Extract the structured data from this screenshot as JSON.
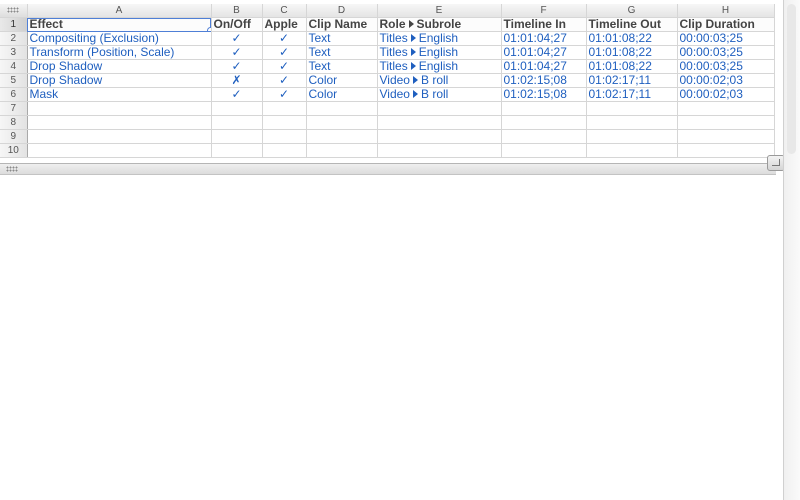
{
  "columns": [
    "A",
    "B",
    "C",
    "D",
    "E",
    "F",
    "G",
    "H"
  ],
  "rows": [
    "1",
    "2",
    "3",
    "4",
    "5",
    "6",
    "7",
    "8",
    "9",
    "10"
  ],
  "header": {
    "effect": "Effect",
    "onoff": "On/Off",
    "apple": "Apple",
    "clip_name": "Clip Name",
    "role": "Role",
    "subrole": "Subrole",
    "timeline_in": "Timeline In",
    "timeline_out": "Timeline Out",
    "clip_duration": "Clip Duration"
  },
  "data": [
    {
      "effect": "Compositing (Exclusion)",
      "onoff": "✓",
      "apple": "✓",
      "clip_name": "Text",
      "role": "Titles",
      "subrole": "English",
      "timeline_in": "01:01:04;27",
      "timeline_out": "01:01:08;22",
      "clip_duration": "00:00:03;25"
    },
    {
      "effect": "Transform (Position, Scale)",
      "onoff": "✓",
      "apple": "✓",
      "clip_name": "Text",
      "role": "Titles",
      "subrole": "English",
      "timeline_in": "01:01:04;27",
      "timeline_out": "01:01:08;22",
      "clip_duration": "00:00:03;25"
    },
    {
      "effect": "Drop Shadow",
      "onoff": "✓",
      "apple": "✓",
      "clip_name": "Text",
      "role": "Titles",
      "subrole": "English",
      "timeline_in": "01:01:04;27",
      "timeline_out": "01:01:08;22",
      "clip_duration": "00:00:03;25"
    },
    {
      "effect": "Drop Shadow",
      "onoff": "✗",
      "apple": "✓",
      "clip_name": "Color",
      "role": "Video",
      "subrole": "B roll",
      "timeline_in": "01:02:15;08",
      "timeline_out": "01:02:17;11",
      "clip_duration": "00:00:02;03"
    },
    {
      "effect": "Mask",
      "onoff": "✓",
      "apple": "✓",
      "clip_name": "Color",
      "role": "Video",
      "subrole": "B roll",
      "timeline_in": "01:02:15;08",
      "timeline_out": "01:02:17;11",
      "clip_duration": "00:00:02;03"
    }
  ],
  "colors": {
    "data_text": "#1f5fbf",
    "header_text": "#444444",
    "selection": "#4f7fd6"
  },
  "icons": {
    "role_separator": "disclosure-triangle-icon",
    "top_grip": "grip-dots-icon",
    "bottom_grip": "grip-dots-icon",
    "resize": "resize-corner-icon"
  }
}
